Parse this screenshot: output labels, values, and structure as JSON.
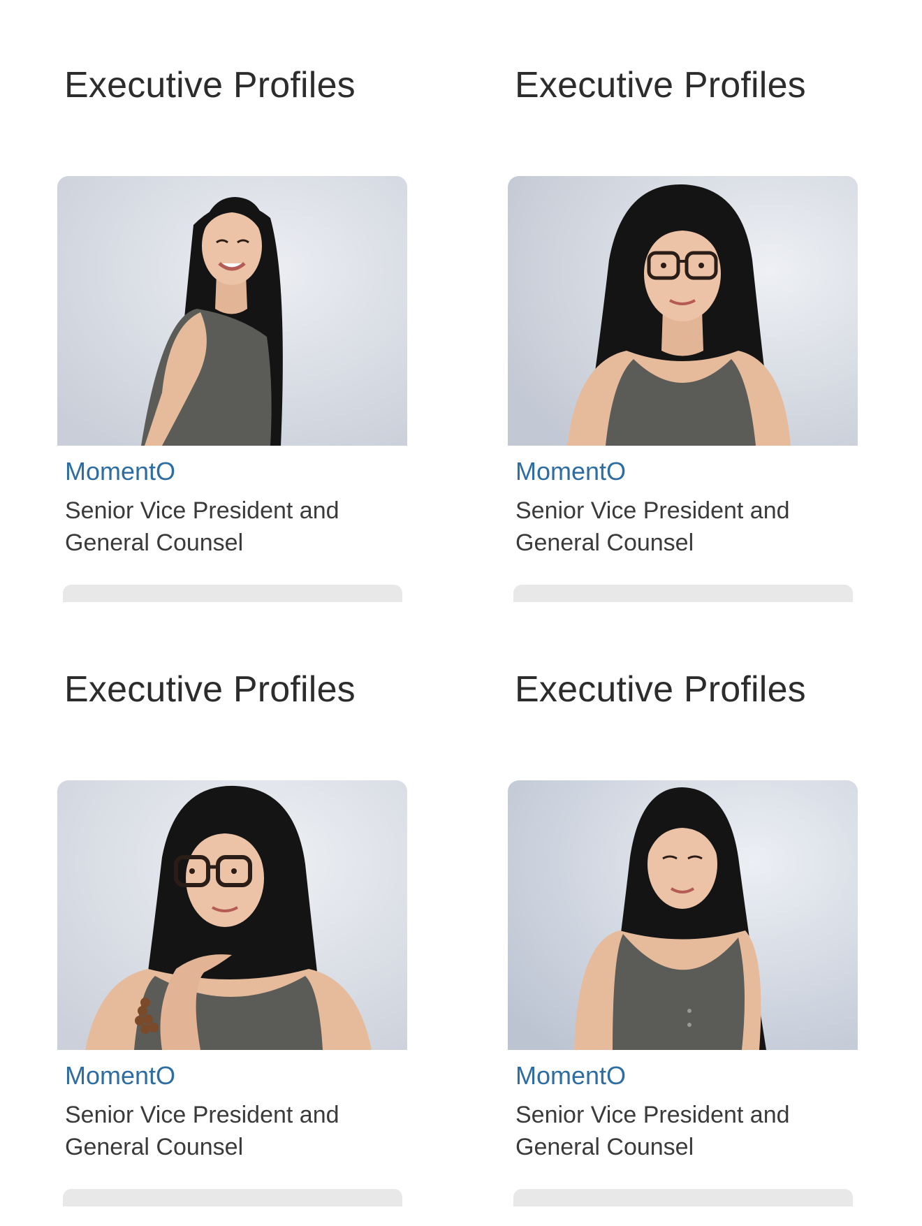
{
  "profiles": [
    {
      "heading": "Executive Profiles",
      "photo_icon": "portrait-photo-icon",
      "company": "MomentO",
      "role": "Senior Vice President and General Counsel"
    },
    {
      "heading": "Executive Profiles",
      "photo_icon": "portrait-photo-icon",
      "company": "MomentO",
      "role": "Senior Vice President and General Counsel"
    },
    {
      "heading": "Executive Profiles",
      "photo_icon": "portrait-photo-icon",
      "company": "MomentO",
      "role": "Senior Vice President and General Counsel"
    },
    {
      "heading": "Executive Profiles",
      "photo_icon": "portrait-photo-icon",
      "company": "MomentO",
      "role": "Senior Vice President and General Counsel"
    }
  ],
  "colors": {
    "heading": "#2c2c2c",
    "company_link": "#2e6da1",
    "role_text": "#3a3a3a",
    "photo_background": "#dfe3ea",
    "hair": "#141414",
    "top": "#5b5b58",
    "skin": "#e8bfa2"
  }
}
